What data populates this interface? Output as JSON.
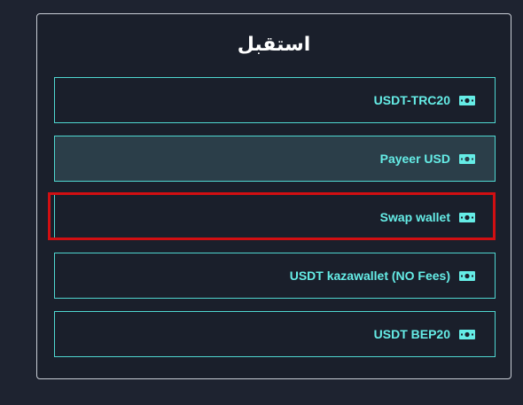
{
  "panel": {
    "title": "استقبل"
  },
  "options": [
    {
      "label": "USDT-TRC20",
      "icon": "money-bill-icon"
    },
    {
      "label": "Payeer USD",
      "icon": "money-bill-icon"
    },
    {
      "label": "Swap wallet",
      "icon": "money-bill-icon"
    },
    {
      "label": "USDT kazawallet (NO Fees)",
      "icon": "money-bill-icon"
    },
    {
      "label": "USDT BEP20",
      "icon": "money-bill-icon"
    }
  ],
  "selected_option": "Payeer USD",
  "colors": {
    "background": "#1e2330",
    "panel": "#1a1f2b",
    "accent": "#4fd6d0",
    "label": "#65ece6",
    "selected_bg": "#2b3e49",
    "highlight": "#d10f12"
  }
}
